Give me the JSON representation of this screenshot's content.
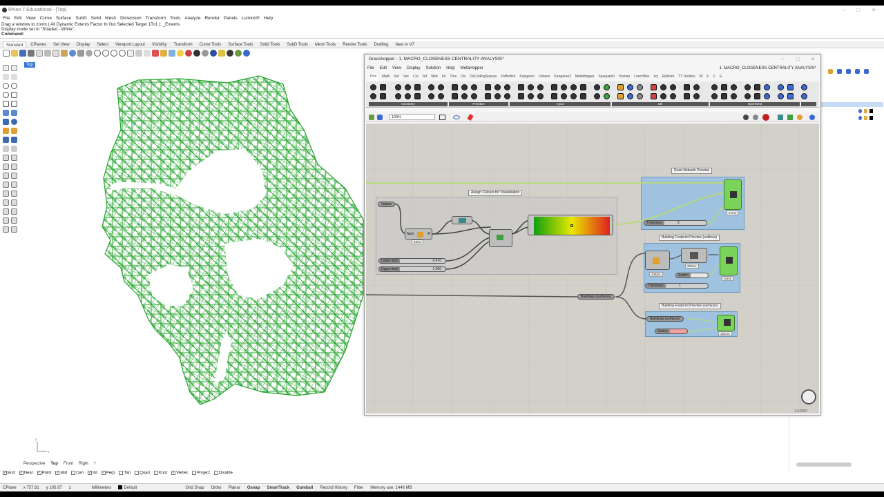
{
  "rhino": {
    "title": "Rhino 7 Educational - [Top]",
    "menu": [
      "File",
      "Edit",
      "View",
      "Curve",
      "Surface",
      "SubD",
      "Solid",
      "Mesh",
      "Dimension",
      "Transform",
      "Tools",
      "Analyze",
      "Render",
      "Panels",
      "Lumion®",
      "Help"
    ],
    "command_history": [
      "Drag a window to zoom ( All  Dynamic  Extents  Factor  In  Out  Selected  Target  1To1 ): _Extents",
      "Display mode set to \"Shaded - White\".",
      "Command:"
    ],
    "tabs": [
      "Standard",
      "CPlanes",
      "Set View",
      "Display",
      "Select",
      "Viewport Layout",
      "Visibility",
      "Transform",
      "Curve Tools",
      "Surface Tools",
      "Solid Tools",
      "SubD Tools",
      "Mesh Tools",
      "Render Tools",
      "Drafting",
      "New in V7"
    ],
    "active_tab": "Standard",
    "viewport_label": "Top",
    "viewport_tabs": [
      "Perspective",
      "Top",
      "Front",
      "Right"
    ],
    "osnaps": [
      {
        "label": "End",
        "checked": true
      },
      {
        "label": "Near",
        "checked": true
      },
      {
        "label": "Point",
        "checked": true
      },
      {
        "label": "Mid",
        "checked": true
      },
      {
        "label": "Cen",
        "checked": false
      },
      {
        "label": "Int",
        "checked": true
      },
      {
        "label": "Perp",
        "checked": true
      },
      {
        "label": "Tan",
        "checked": false
      },
      {
        "label": "Quad",
        "checked": false
      },
      {
        "label": "Knot",
        "checked": false
      },
      {
        "label": "Vertex",
        "checked": true
      },
      {
        "label": "Project",
        "checked": false
      },
      {
        "label": "Disable",
        "checked": false
      }
    ],
    "status": {
      "cplane": "CPlane",
      "x": "x 757.81",
      "y": "y 105.97",
      "z": "z",
      "units": "Millimeters",
      "layer": "Default",
      "toggles": [
        "Grid Snap",
        "Ortho",
        "Planar",
        "Osnap",
        "SmartTrack",
        "Gumball",
        "Record History",
        "Filter"
      ],
      "bold_toggles": [
        "Osnap",
        "SmartTrack",
        "Gumball"
      ],
      "memory": "Memory use: 1446 MB"
    },
    "accent_color": "#3c78d8",
    "network_color": "#22a32a"
  },
  "grasshopper": {
    "title": "Grasshopper - 1. MACRO_CLOSENESS CENTRALITY ANALYSIS*",
    "doc_title": "1. MACRO_CLOSENESS CENTRALITY ANALYSIS*",
    "menu": [
      "File",
      "Edit",
      "View",
      "Display",
      "Solution",
      "Help",
      "MetaHopper"
    ],
    "component_tabs": [
      "Prm",
      "Math",
      "Set",
      "Vec",
      "Crv",
      "Srf",
      "Msh",
      "Int",
      "Trns",
      "Dis",
      "DeCodingSpaces",
      "Pufferfish",
      "Kangaroo",
      "Urbano",
      "Kangaroo2",
      "MetaHopper",
      "Sasquatch",
      "Human",
      "LunchBox",
      "Ivy",
      "Elefront",
      "TT Toolbox",
      "W",
      "F",
      "C",
      "E"
    ],
    "active_tab": "Prm",
    "ribbon_groups": [
      "Geometry",
      "Primitive",
      "Input",
      "Util",
      "OpenNest"
    ],
    "zoom": "100%",
    "version": "1.0.0007",
    "groups": [
      {
        "label": "Assign Colours for Visualisation"
      },
      {
        "label": "Road Network Preview"
      },
      {
        "label": "Building Footprint Preview (outlines)"
      },
      {
        "label": "Building Footprint Preview (surfaces)"
      }
    ],
    "params": {
      "values": "Values",
      "buildings1": "Buildings (surfaces)",
      "buildings2": "Buildings (surfaces)"
    },
    "sliders": {
      "lower": {
        "label": "Lower limit",
        "value": "0.470"
      },
      "upper": {
        "label": "Upper limit",
        "value": "1.000"
      },
      "thickness1": {
        "label": "Thickness",
        "value": "2"
      },
      "thickness2": {
        "label": "Thickness",
        "value": "1"
      }
    },
    "toggles": {
      "switch1": "Switch",
      "switch2": "Switch"
    },
    "timers": {
      "remap": "18ms",
      "custom_preview1": "17ms",
      "brep_edges": "446ms",
      "shatter": "306ms",
      "custom_preview2": "35ms",
      "custom_preview3": "162ms"
    },
    "gradient": {
      "colors": [
        "#10a010",
        "#e8e800",
        "#e02020"
      ]
    }
  }
}
